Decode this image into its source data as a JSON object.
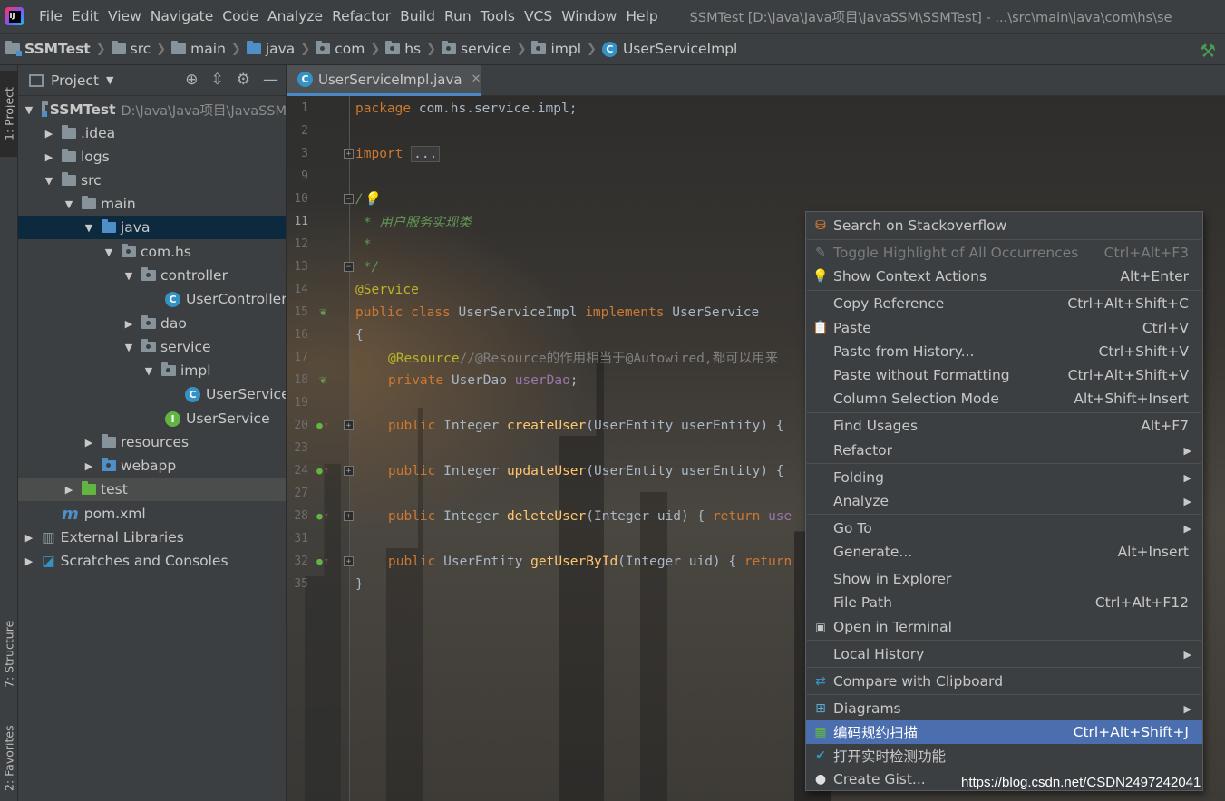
{
  "menubar": {
    "items": [
      "File",
      "Edit",
      "View",
      "Navigate",
      "Code",
      "Analyze",
      "Refactor",
      "Build",
      "Run",
      "Tools",
      "VCS",
      "Window",
      "Help"
    ],
    "window_title": "SSMTest [D:\\Java\\Java项目\\JavaSSM\\SSMTest] - ...\\src\\main\\java\\com\\hs\\se"
  },
  "navbar": {
    "crumbs": [
      "SSMTest",
      "src",
      "main",
      "java",
      "com",
      "hs",
      "service",
      "impl",
      "UserServiceImpl"
    ]
  },
  "left_stripe": {
    "project": "1: Project",
    "structure": "7: Structure",
    "favorites": "2: Favorites"
  },
  "project_panel": {
    "title": "Project",
    "tree": [
      {
        "label": "SSMTest",
        "hint": "D:\\Java\\Java项目\\JavaSSM"
      },
      {
        "label": ".idea"
      },
      {
        "label": "logs"
      },
      {
        "label": "src"
      },
      {
        "label": "main"
      },
      {
        "label": "java"
      },
      {
        "label": "com.hs"
      },
      {
        "label": "controller"
      },
      {
        "label": "UserController"
      },
      {
        "label": "dao"
      },
      {
        "label": "service"
      },
      {
        "label": "impl"
      },
      {
        "label": "UserServiceImpl"
      },
      {
        "label": "UserService"
      },
      {
        "label": "resources"
      },
      {
        "label": "webapp"
      },
      {
        "label": "test"
      },
      {
        "label": "pom.xml"
      },
      {
        "label": "External Libraries"
      },
      {
        "label": "Scratches and Consoles"
      }
    ]
  },
  "editor": {
    "tab": "UserServiceImpl.java",
    "line_numbers": [
      "1",
      "2",
      "3",
      "9",
      "10",
      "11",
      "12",
      "13",
      "14",
      "15",
      "16",
      "17",
      "18",
      "19",
      "20",
      "23",
      "24",
      "27",
      "28",
      "31",
      "32",
      "35"
    ],
    "code": {
      "l1_kw": "package ",
      "l1_rest": "com.hs.service.impl;",
      "l3_kw": "import ",
      "l3_fold": "...",
      "l10": "/",
      "l11": " * 用户服务实现类",
      "l12": " *",
      "l13": " */",
      "l14": "@Service",
      "l15_kw1": "public class ",
      "l15_name": "UserServiceImpl ",
      "l15_kw2": "implements ",
      "l15_iface": "UserService",
      "l16": "{",
      "l17_ann": "@Resource",
      "l17_cm": "//@Resource的作用相当于@Autowired,都可以用来",
      "l18_kw": "private ",
      "l18_type": "UserDao ",
      "l18_field": "userDao",
      "l18_end": ";",
      "l20_kw": "public ",
      "l20_type": "Integer ",
      "l20_fn": "createUser",
      "l20_rest": "(UserEntity userEntity) {",
      "l24_kw": "public ",
      "l24_type": "Integer ",
      "l24_fn": "updateUser",
      "l24_rest": "(UserEntity userEntity) {",
      "l28_kw": "public ",
      "l28_type": "Integer ",
      "l28_fn": "deleteUser",
      "l28_rest": "(Integer uid) { ",
      "l28_ret": "return ",
      "l28_tail": "use",
      "l32_kw": "public ",
      "l32_type": "UserEntity ",
      "l32_fn": "getUserById",
      "l32_rest": "(Integer uid) { ",
      "l32_ret": "return",
      "l35": "}"
    }
  },
  "context_menu": {
    "items": [
      {
        "label": "Search on Stackoverflow",
        "shortcut": ""
      },
      {
        "label": "Toggle Highlight of All Occurrences",
        "shortcut": "Ctrl+Alt+F3"
      },
      {
        "label": "Show Context Actions",
        "shortcut": "Alt+Enter"
      },
      {
        "label": "Copy Reference",
        "shortcut": "Ctrl+Alt+Shift+C"
      },
      {
        "label": "Paste",
        "shortcut": "Ctrl+V"
      },
      {
        "label": "Paste from History...",
        "shortcut": "Ctrl+Shift+V"
      },
      {
        "label": "Paste without Formatting",
        "shortcut": "Ctrl+Alt+Shift+V"
      },
      {
        "label": "Column Selection Mode",
        "shortcut": "Alt+Shift+Insert"
      },
      {
        "label": "Find Usages",
        "shortcut": "Alt+F7"
      },
      {
        "label": "Refactor",
        "shortcut": ""
      },
      {
        "label": "Folding",
        "shortcut": ""
      },
      {
        "label": "Analyze",
        "shortcut": ""
      },
      {
        "label": "Go To",
        "shortcut": ""
      },
      {
        "label": "Generate...",
        "shortcut": "Alt+Insert"
      },
      {
        "label": "Show in Explorer",
        "shortcut": ""
      },
      {
        "label": "File Path",
        "shortcut": "Ctrl+Alt+F12"
      },
      {
        "label": "Open in Terminal",
        "shortcut": ""
      },
      {
        "label": "Local History",
        "shortcut": ""
      },
      {
        "label": "Compare with Clipboard",
        "shortcut": ""
      },
      {
        "label": "Diagrams",
        "shortcut": ""
      },
      {
        "label": "编码规约扫描",
        "shortcut": "Ctrl+Alt+Shift+J"
      },
      {
        "label": "打开实时检测功能",
        "shortcut": ""
      },
      {
        "label": "Create Gist...",
        "shortcut": ""
      }
    ]
  },
  "watermark": "https://blog.csdn.net/CSDN2497242041",
  "colors": {
    "menu_bg": "#3c3f41",
    "selection": "#4b6eaf",
    "tree_selection": "#0d293e",
    "keyword": "#cc7832",
    "annotation": "#bbb529",
    "method": "#ffc66d",
    "field": "#9876aa",
    "doc_comment": "#629755"
  }
}
